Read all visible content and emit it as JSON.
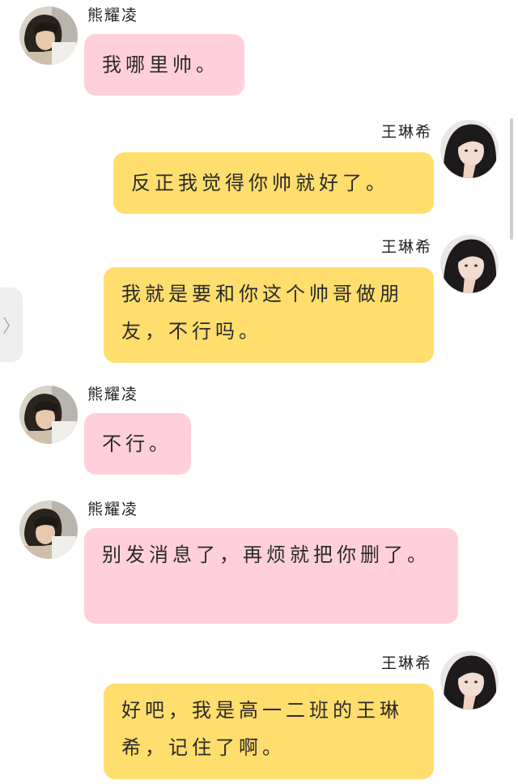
{
  "participants": {
    "other": {
      "name": "熊耀凌",
      "bubble_color": "#ffd0dc"
    },
    "me": {
      "name": "王琳希",
      "bubble_color": "#ffde6d"
    }
  },
  "messages": [
    {
      "side": "left",
      "sender": "熊耀凌",
      "text": "我哪里帅。"
    },
    {
      "side": "right",
      "sender": "王琳希",
      "text": "反正我觉得你帅就好了。"
    },
    {
      "side": "right",
      "sender": "王琳希",
      "text": "我就是要和你这个帅哥做朋友，不行吗。"
    },
    {
      "side": "left",
      "sender": "熊耀凌",
      "text": "不行。"
    },
    {
      "side": "left",
      "sender": "熊耀凌",
      "text": "别发消息了，再烦就把你删了。"
    },
    {
      "side": "right",
      "sender": "王琳希",
      "text": "好吧，我是高一二班的王琳希，记住了啊。"
    }
  ],
  "side_tab": {
    "icon": "chevron-right-icon",
    "glyph": "〉"
  }
}
